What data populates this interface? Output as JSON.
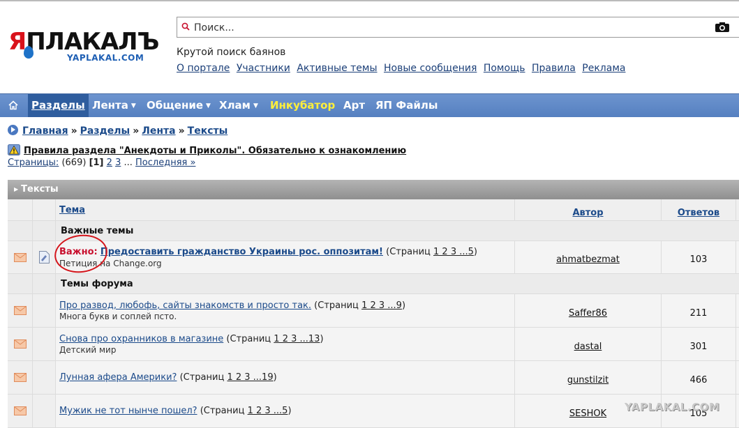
{
  "logo": {
    "main_prefix": "Я",
    "main_rest": "ПЛАКАЛЪ",
    "sub": "YAPLAKAL.COM"
  },
  "search": {
    "placeholder": "Поиск..."
  },
  "tagline": "Крутой поиск баянов",
  "top_links": [
    "О портале",
    "Участники",
    "Активные темы",
    "Новые сообщения",
    "Помощь",
    "Правила",
    "Реклама"
  ],
  "nav": {
    "items": [
      {
        "label": "Разделы"
      },
      {
        "label": "Лента"
      },
      {
        "label": "Общение"
      },
      {
        "label": "Хлам"
      },
      {
        "label": "Инкубатор"
      },
      {
        "label": "Арт"
      },
      {
        "label": "ЯП Файлы"
      }
    ]
  },
  "breadcrumb": [
    "Главная",
    "Разделы",
    "Лента",
    "Тексты"
  ],
  "breadcrumb_sep": "»",
  "rules_link": "Правила раздела \"Анекдоты и Приколы\". Обязательно к ознакомлению",
  "pagination": {
    "label": "Страницы:",
    "count": "(669)",
    "current": "[1]",
    "pages": [
      "2",
      "3"
    ],
    "ellipsis": "...",
    "last": "Последняя »"
  },
  "section_title": "Тексты",
  "table": {
    "headers": {
      "topic": "Тема",
      "author": "Автор",
      "answers": "Ответов"
    },
    "group_important": "Важные темы",
    "group_forum": "Темы форума",
    "important": {
      "label": "Важно:",
      "title": "Предоставить гражданство Украины рос. оппозитам!",
      "pages_prefix": "(Страниц",
      "pages": "1 2 3 ...5",
      "pages_suffix": ")",
      "subtitle": "Петиция на Change.org",
      "author": "ahmatbezmat",
      "answers": "103"
    },
    "topics": [
      {
        "title": "Про развод, любофь, сайты знакомств и просто так.",
        "pages_prefix": "(Страниц",
        "pages": "1 2 3 ...9",
        "pages_suffix": ")",
        "subtitle": "Многа букв и соплей псто.",
        "author": "Saffer86",
        "answers": "211"
      },
      {
        "title": "Снова про охранников в магазине",
        "pages_prefix": "(Страниц",
        "pages": "1 2 3 ...13",
        "pages_suffix": ")",
        "subtitle": "Детский мир",
        "author": "dastal",
        "answers": "301"
      },
      {
        "title": "Лунная афера Америки?",
        "pages_prefix": "(Страниц",
        "pages": "1 2 3 ...19",
        "pages_suffix": ")",
        "subtitle": "",
        "author": "gunstilzit",
        "answers": "466"
      },
      {
        "title": "Мужик не тот нынче пошел?",
        "pages_prefix": "(Страниц",
        "pages": "1 2 3 ...5",
        "pages_suffix": ")",
        "subtitle": "",
        "author": "SESHOK",
        "answers": "105"
      }
    ]
  },
  "watermark": "YAPLAKAL.COM",
  "colors": {
    "nav_bg": "#5f89c8",
    "nav_active": "#2f5d9e",
    "incubator": "#ffef3a",
    "important": "#c8102e",
    "circle": "#d4151b"
  }
}
